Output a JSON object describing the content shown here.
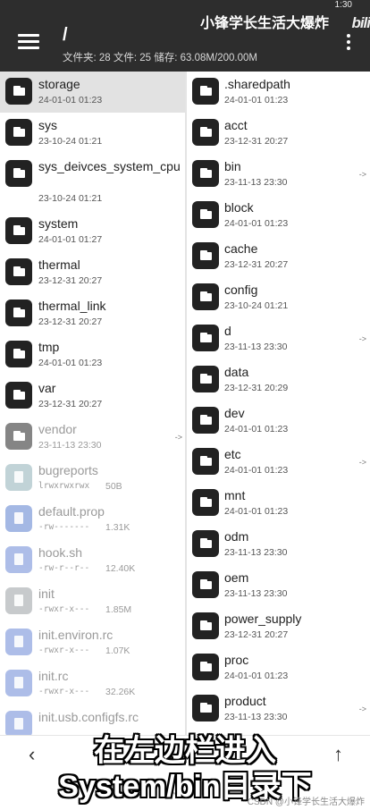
{
  "header": {
    "path": "/",
    "info": "文件夹: 28  文件: 25  储存: 63.08M/200.00M",
    "channel": "小锋学长生活大爆炸",
    "clock": "1:30",
    "logo": "bili"
  },
  "left_pane": [
    {
      "name": "storage",
      "date": "24-01-01 01:23",
      "type": "folder",
      "selected": true
    },
    {
      "name": "sys",
      "date": "23-10-24 01:21",
      "type": "folder"
    },
    {
      "name": "sys_deivces_system_cpu",
      "date": "23-10-24 01:21",
      "type": "folder"
    },
    {
      "name": "system",
      "date": "24-01-01 01:27",
      "type": "folder"
    },
    {
      "name": "thermal",
      "date": "23-12-31 20:27",
      "type": "folder"
    },
    {
      "name": "thermal_link",
      "date": "23-12-31 20:27",
      "type": "folder"
    },
    {
      "name": "tmp",
      "date": "24-01-01 01:23",
      "type": "folder"
    },
    {
      "name": "var",
      "date": "23-12-31 20:27",
      "type": "folder"
    },
    {
      "name": "vendor",
      "date": "23-11-13 23:30",
      "type": "folder",
      "arrow": "->",
      "dim": true
    },
    {
      "name": "bugreports",
      "perm": "lrwxrwxrwx",
      "size": "50B",
      "type": "file",
      "color": "#8fb0b8",
      "dim": true
    },
    {
      "name": "default.prop",
      "perm": "-rw-------",
      "size": "1.31K",
      "type": "file",
      "color": "#5b7fcf",
      "dim": true
    },
    {
      "name": "hook.sh",
      "perm": "-rw-r--r--",
      "size": "12.40K",
      "type": "file",
      "color": "#6b88d6",
      "dim": true
    },
    {
      "name": "init",
      "perm": "-rwxr-x---",
      "size": "1.85M",
      "type": "file",
      "color": "#9aa0a4",
      "dim": true
    },
    {
      "name": "init.environ.rc",
      "perm": "-rwxr-x---",
      "size": "1.07K",
      "type": "file",
      "color": "#6b88d6",
      "dim": true
    },
    {
      "name": "init.rc",
      "perm": "-rwxr-x---",
      "size": "32.26K",
      "type": "file",
      "color": "#6b88d6",
      "dim": true
    },
    {
      "name": "init.usb.configfs.rc",
      "perm": "",
      "size": "",
      "type": "file",
      "color": "#6b88d6",
      "dim": true
    }
  ],
  "right_pane": [
    {
      "name": ".sharedpath",
      "date": "24-01-01 01:23",
      "type": "folder"
    },
    {
      "name": "acct",
      "date": "23-12-31 20:27",
      "type": "folder"
    },
    {
      "name": "bin",
      "date": "23-11-13 23:30",
      "type": "folder",
      "arrow": "->"
    },
    {
      "name": "block",
      "date": "24-01-01 01:23",
      "type": "folder"
    },
    {
      "name": "cache",
      "date": "23-12-31 20:27",
      "type": "folder"
    },
    {
      "name": "config",
      "date": "23-10-24 01:21",
      "type": "folder"
    },
    {
      "name": "d",
      "date": "23-11-13 23:30",
      "type": "folder",
      "arrow": "->"
    },
    {
      "name": "data",
      "date": "23-12-31 20:29",
      "type": "folder"
    },
    {
      "name": "dev",
      "date": "24-01-01 01:23",
      "type": "folder"
    },
    {
      "name": "etc",
      "date": "24-01-01 01:23",
      "type": "folder",
      "arrow": "->"
    },
    {
      "name": "mnt",
      "date": "24-01-01 01:23",
      "type": "folder"
    },
    {
      "name": "odm",
      "date": "23-11-13 23:30",
      "type": "folder"
    },
    {
      "name": "oem",
      "date": "23-11-13 23:30",
      "type": "folder"
    },
    {
      "name": "power_supply",
      "date": "23-12-31 20:27",
      "type": "folder"
    },
    {
      "name": "proc",
      "date": "24-01-01 01:23",
      "type": "folder"
    },
    {
      "name": "product",
      "date": "23-11-13 23:30",
      "type": "folder",
      "arrow": "->"
    }
  ],
  "bottom": {
    "back_icon": "‹",
    "up_icon": "↑"
  },
  "subtitle": {
    "line1": "在左边栏进入",
    "line2": "System/bin目录下"
  },
  "watermark": "CSDN @小锋学长生活大爆炸"
}
